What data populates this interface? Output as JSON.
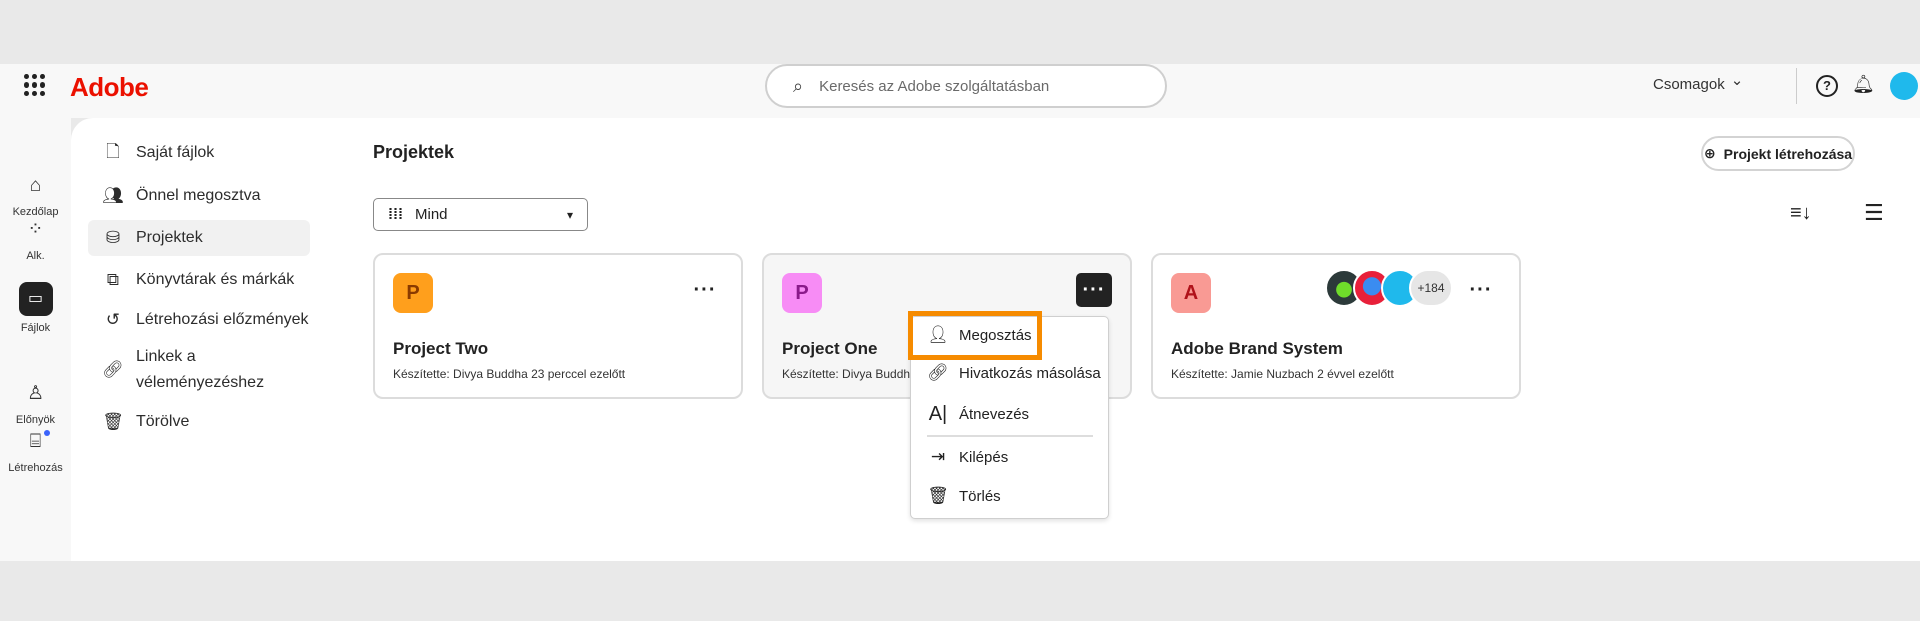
{
  "header": {
    "brand": "Adobe",
    "search_placeholder": "Keresés az Adobe szolgáltatásban",
    "plans": "Csomagok",
    "plans_chevron": "⌄"
  },
  "rail": [
    {
      "label": "Kezdőlap",
      "icon": "home-icon"
    },
    {
      "label": "Alk.",
      "icon": "apps-icon"
    },
    {
      "label": "Fájlok",
      "icon": "folder-icon"
    },
    {
      "label": "Előnyök",
      "icon": "award-icon"
    },
    {
      "label": "Létrehozás",
      "icon": "create-icon"
    }
  ],
  "nav": [
    {
      "label": "Saját fájlok"
    },
    {
      "label": "Önnel megosztva"
    },
    {
      "label": "Projektek"
    },
    {
      "label": "Könyvtárak és márkák"
    },
    {
      "label": "Létrehozási előzmények"
    },
    {
      "label": "Linkek a véleményezéshez",
      "line1": "Linkek a",
      "line2": "véleményezéshez"
    },
    {
      "label": "Törölve"
    }
  ],
  "main": {
    "title": "Projektek",
    "filter": "Mind",
    "create_button": "Projekt létrehozása"
  },
  "cards": [
    {
      "letter": "P",
      "title": "Project Two",
      "subtitle": "Készítette: Divya Buddha 23 perccel ezelőtt",
      "color": "#ff9f1c",
      "text_color": "#8a3a00"
    },
    {
      "letter": "P",
      "title": "Project One",
      "subtitle": "Készítette: Divya Buddha",
      "color": "#f78cf5",
      "text_color": "#8a1a8a"
    },
    {
      "letter": "A",
      "title": "Adobe Brand System",
      "subtitle": "Készítette: Jamie Nuzbach 2 évvel ezelőtt",
      "color": "#f99a94",
      "text_color": "#b0121a",
      "collaborators_more": "+184"
    }
  ],
  "menu": [
    {
      "label": "Megosztás",
      "icon": "share-user-icon"
    },
    {
      "label": "Hivatkozás másolása",
      "icon": "link-icon"
    },
    {
      "label": "Átnevezés",
      "icon": "rename-icon"
    },
    {
      "label": "Kilépés",
      "icon": "exit-icon"
    },
    {
      "label": "Törlés",
      "icon": "trash-icon"
    }
  ],
  "colors": {
    "highlight": "#f68b00",
    "brand": "#eb1000"
  }
}
